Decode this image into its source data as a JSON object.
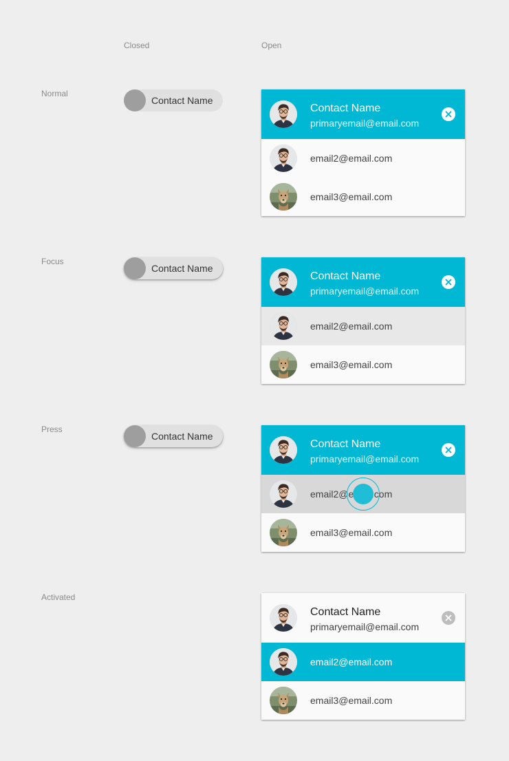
{
  "columns": {
    "closed": "Closed",
    "open": "Open"
  },
  "states": [
    {
      "label": "Normal"
    },
    {
      "label": "Focus"
    },
    {
      "label": "Press"
    },
    {
      "label": "Activated"
    }
  ],
  "chip": {
    "label": "Contact Name"
  },
  "contact": {
    "name": "Contact Name",
    "primary_email": "primaryemail@email.com",
    "email2": "email2@email.com",
    "email3": "email3@email.com"
  },
  "colors": {
    "accent": "#00b8d4",
    "background": "#eeeeee",
    "chip": "#e0e0e0",
    "chip_avatar": "#9e9e9e",
    "focus_row": "#e8e8e8",
    "press_row": "#d8d8d8"
  },
  "icons": {
    "close": "close-icon",
    "avatar_person": "person-avatar",
    "avatar_dog": "dog-avatar"
  }
}
